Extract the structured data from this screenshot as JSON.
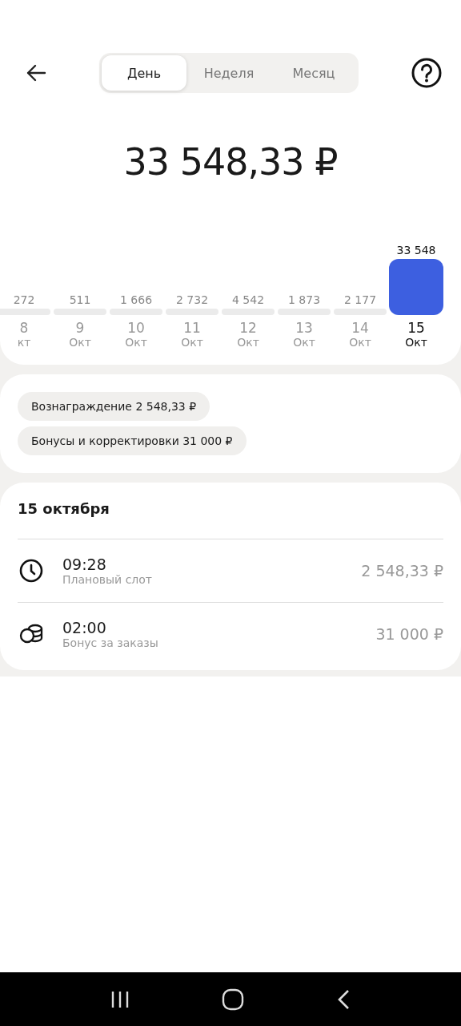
{
  "tabs": [
    {
      "label": "День",
      "selected": true
    },
    {
      "label": "Неделя",
      "selected": false
    },
    {
      "label": "Месяц",
      "selected": false
    }
  ],
  "total": "33 548,33 ₽",
  "days": [
    {
      "value": "272",
      "day": "8",
      "month": "кт",
      "selected": false
    },
    {
      "value": "511",
      "day": "9",
      "month": "Окт",
      "selected": false
    },
    {
      "value": "1 666",
      "day": "10",
      "month": "Окт",
      "selected": false
    },
    {
      "value": "2 732",
      "day": "11",
      "month": "Окт",
      "selected": false
    },
    {
      "value": "4 542",
      "day": "12",
      "month": "Окт",
      "selected": false
    },
    {
      "value": "1 873",
      "day": "13",
      "month": "Окт",
      "selected": false
    },
    {
      "value": "2 177",
      "day": "14",
      "month": "Окт",
      "selected": false
    },
    {
      "value": "33 548",
      "day": "15",
      "month": "Окт",
      "selected": true
    }
  ],
  "chips": [
    "Вознаграждение 2 548,33 ₽",
    "Бонусы и корректировки 31 000 ₽"
  ],
  "section": {
    "title": "15 октября",
    "items": [
      {
        "kind": "clock",
        "time": "09:28",
        "label": "Плановый слот",
        "amount": "2 548,33 ₽"
      },
      {
        "kind": "coins",
        "time": "02:00",
        "label": "Бонус за заказы",
        "amount": "31 000 ₽"
      }
    ]
  }
}
